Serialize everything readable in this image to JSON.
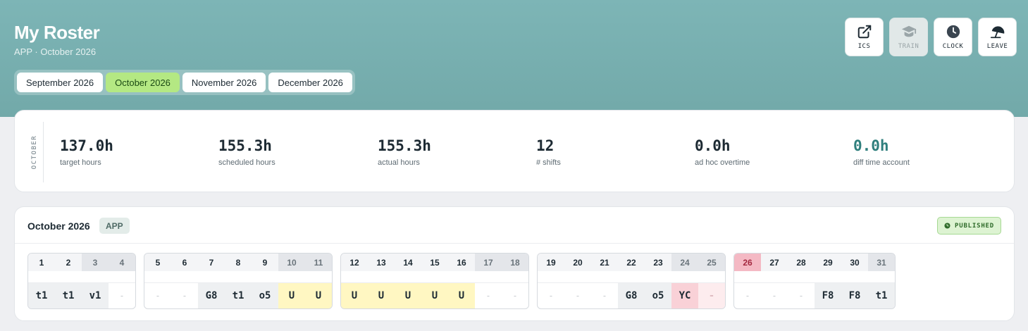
{
  "header": {
    "title": "My Roster",
    "subtitle": "APP · October 2026",
    "month_tabs": [
      {
        "label": "September 2026",
        "active": false
      },
      {
        "label": "October 2026",
        "active": true
      },
      {
        "label": "November 2026",
        "active": false
      },
      {
        "label": "December 2026",
        "active": false
      }
    ],
    "actions": [
      {
        "label": "ICS",
        "icon": "external-link-icon",
        "disabled": false
      },
      {
        "label": "TRAIN",
        "icon": "graduation-cap-icon",
        "disabled": true
      },
      {
        "label": "CLOCK",
        "icon": "clock-icon",
        "disabled": false
      },
      {
        "label": "LEAVE",
        "icon": "beach-umbrella-icon",
        "disabled": false
      }
    ]
  },
  "stats": {
    "month_label": "OCTOBER",
    "items": [
      {
        "value": "137.0h",
        "label": "target hours"
      },
      {
        "value": "155.3h",
        "label": "scheduled hours"
      },
      {
        "value": "155.3h",
        "label": "actual hours"
      },
      {
        "value": "12",
        "label": "# shifts"
      },
      {
        "value": "0.0h",
        "label": "ad hoc overtime"
      },
      {
        "value": "0.0h",
        "label": "diff time account"
      }
    ]
  },
  "roster": {
    "title": "October 2026",
    "team": "APP",
    "status": "PUBLISHED",
    "weeks": [
      [
        {
          "day": "1",
          "shift": "t1",
          "kind": "grey"
        },
        {
          "day": "2",
          "shift": "t1",
          "kind": "grey"
        },
        {
          "day": "3",
          "shift": "v1",
          "kind": "grey",
          "weekend": true
        },
        {
          "day": "4",
          "shift": "-",
          "kind": "dash",
          "weekend": true
        }
      ],
      [
        {
          "day": "5",
          "shift": "-",
          "kind": "dash"
        },
        {
          "day": "6",
          "shift": "-",
          "kind": "dash"
        },
        {
          "day": "7",
          "shift": "G8",
          "kind": "grey"
        },
        {
          "day": "8",
          "shift": "t1",
          "kind": "grey"
        },
        {
          "day": "9",
          "shift": "o5",
          "kind": "grey"
        },
        {
          "day": "10",
          "shift": "U",
          "kind": "yellow",
          "weekend": true
        },
        {
          "day": "11",
          "shift": "U",
          "kind": "yellow",
          "weekend": true
        }
      ],
      [
        {
          "day": "12",
          "shift": "U",
          "kind": "yellow"
        },
        {
          "day": "13",
          "shift": "U",
          "kind": "yellow"
        },
        {
          "day": "14",
          "shift": "U",
          "kind": "yellow"
        },
        {
          "day": "15",
          "shift": "U",
          "kind": "yellow"
        },
        {
          "day": "16",
          "shift": "U",
          "kind": "yellow"
        },
        {
          "day": "17",
          "shift": "-",
          "kind": "dash",
          "weekend": true
        },
        {
          "day": "18",
          "shift": "-",
          "kind": "dash",
          "weekend": true
        }
      ],
      [
        {
          "day": "19",
          "shift": "-",
          "kind": "dash"
        },
        {
          "day": "20",
          "shift": "-",
          "kind": "dash"
        },
        {
          "day": "21",
          "shift": "-",
          "kind": "dash"
        },
        {
          "day": "22",
          "shift": "G8",
          "kind": "grey"
        },
        {
          "day": "23",
          "shift": "o5",
          "kind": "grey"
        },
        {
          "day": "24",
          "shift": "YC",
          "kind": "pink",
          "weekend": true
        },
        {
          "day": "25",
          "shift": "-",
          "kind": "lightpink",
          "weekend": true
        }
      ],
      [
        {
          "day": "26",
          "shift": "-",
          "kind": "dash",
          "today": true
        },
        {
          "day": "27",
          "shift": "-",
          "kind": "dash"
        },
        {
          "day": "28",
          "shift": "-",
          "kind": "dash"
        },
        {
          "day": "29",
          "shift": "F8",
          "kind": "grey"
        },
        {
          "day": "30",
          "shift": "F8",
          "kind": "grey"
        },
        {
          "day": "31",
          "shift": "t1",
          "kind": "grey",
          "weekend": true
        }
      ]
    ]
  },
  "colors": {
    "header_bg": "#7db5b6",
    "active_tab": "#b4e883",
    "accent_teal": "#2f7f7d",
    "published_green": "#2f6b2a",
    "today_pink": "#f4b9c4",
    "leave_yellow": "#fff7c2"
  }
}
